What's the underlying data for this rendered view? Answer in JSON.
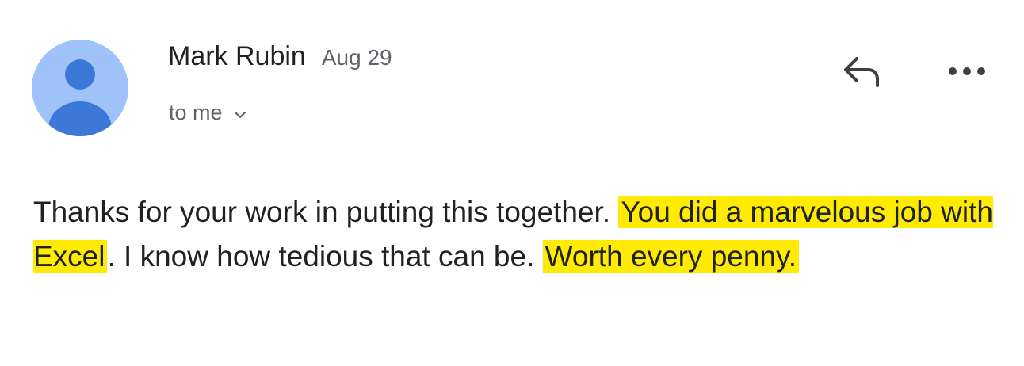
{
  "sender": {
    "name": "Mark Rubin",
    "date": "Aug 29",
    "recipient_label": "to me"
  },
  "icons": {
    "avatar": "person-avatar-icon",
    "reply": "reply-icon",
    "more": "more-horizontal-icon",
    "expand": "chevron-down-icon"
  },
  "colors": {
    "avatar_bg": "#9fc2f8",
    "avatar_figure": "#3b78d8",
    "highlight": "#ffeb00"
  },
  "message": {
    "segment_1": "Thanks for your work in putting this together. ",
    "highlight_1": "You did a marvelous job with Excel",
    "segment_2": ". I know how tedious that can be. ",
    "highlight_2": "Worth every penny."
  }
}
